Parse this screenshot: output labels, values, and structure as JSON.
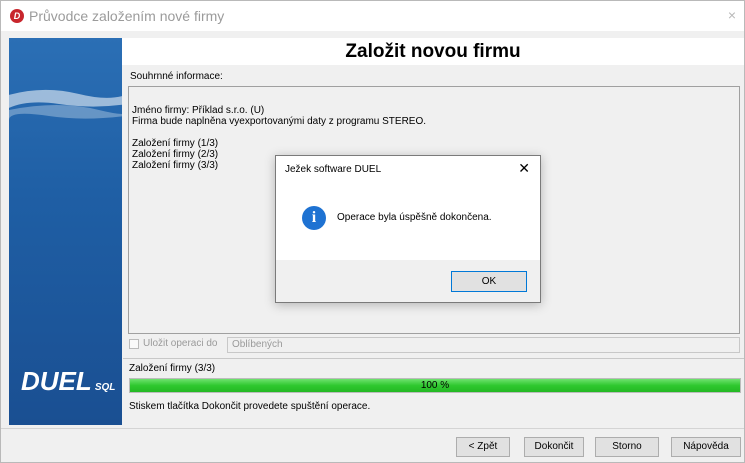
{
  "window": {
    "title": "Průvodce založením nové firmy",
    "close_glyph": "×",
    "app_icon_letter": "D"
  },
  "sidebar": {
    "logo_text": "DUEL",
    "logo_suffix": "SQL"
  },
  "main": {
    "heading": "Založit novou firmu",
    "summary_label": "Souhrnné informace:",
    "summary_lines": [
      "Jméno firmy: Příklad s.r.o. (U)",
      "Firma bude naplněna vyexportovanými daty z programu STEREO.",
      "",
      "Založení firmy (1/3)",
      "Založení firmy (2/3)",
      "Založení firmy (3/3)"
    ],
    "save_label": "Uložit operaci do",
    "save_target": "Oblíbených",
    "progress_label": "Založení firmy (3/3)",
    "progress_percent": 100,
    "progress_text": "100 %",
    "hint": "Stiskem tlačítka Dokončit provedete spuštění operace."
  },
  "buttons": {
    "back": "< Zpět",
    "finish": "Dokončit",
    "cancel": "Storno",
    "help": "Nápověda"
  },
  "dialog": {
    "title": "Ježek software DUEL",
    "close_glyph": "✕",
    "icon": "info-icon",
    "icon_glyph": "i",
    "message": "Operace byla úspěšně dokončena.",
    "ok": "OK"
  },
  "colors": {
    "progress": "#2fc82f",
    "sidebar": "#1f5fa5",
    "info": "#1e72d2"
  }
}
